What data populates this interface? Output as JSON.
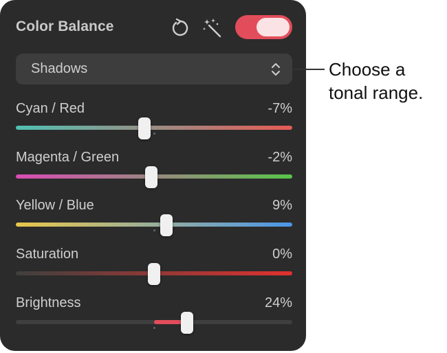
{
  "panel": {
    "title": "Color Balance",
    "reset_icon": "reset-icon",
    "auto_icon": "magic-wand-icon",
    "toggle": {
      "on": true,
      "color": "#e24d5b"
    }
  },
  "dropdown": {
    "selected": "Shadows",
    "icon": "chevron-up-down-icon"
  },
  "sliders": [
    {
      "label": "Cyan / Red",
      "value": "-7%",
      "level": -7,
      "colors": [
        "#4fc1b3",
        "#e65a55"
      ]
    },
    {
      "label": "Magenta / Green",
      "value": "-2%",
      "level": -2,
      "colors": [
        "#da4bb5",
        "#58c54a"
      ]
    },
    {
      "label": "Yellow / Blue",
      "value": "9%",
      "level": 9,
      "colors": [
        "#e9c64a",
        "#4a96ea"
      ]
    },
    {
      "label": "Saturation",
      "value": "0%",
      "level": 0,
      "colors": [
        "#3f3f3f",
        "#e0322f"
      ]
    },
    {
      "label": "Brightness",
      "value": "24%",
      "level": 24,
      "colors": [
        "#3f3f3f",
        "#3f3f3f"
      ],
      "fill_color": "#e24d5b"
    }
  ],
  "callout": {
    "text": "Choose a\ntonal range."
  }
}
